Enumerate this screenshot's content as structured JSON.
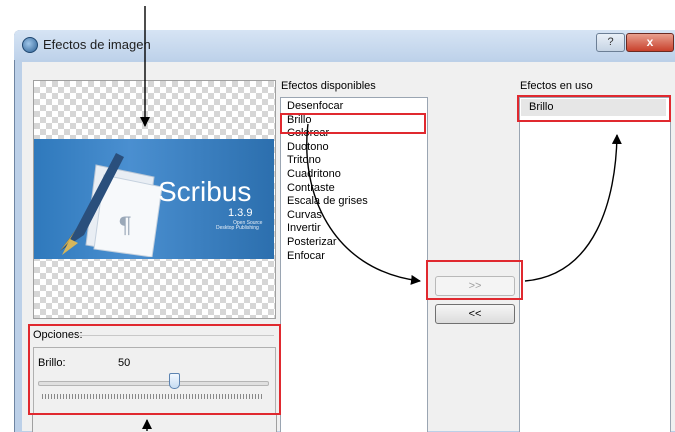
{
  "window": {
    "title": "Efectos de imagen",
    "help_label": "?",
    "close_label": "x"
  },
  "preview": {
    "app_name": "Scribus",
    "version": "1.3.9",
    "tagline_1": "Open Source",
    "tagline_2": "Desktop Publishing"
  },
  "options": {
    "group_label": "Opciones:",
    "param_label": "Brillo:",
    "param_value": "50",
    "slider_fraction": 0.6
  },
  "available": {
    "header": "Efectos disponibles",
    "items": [
      "Desenfocar",
      "Brillo",
      "Colorear",
      "Duotono",
      "Tritono",
      "Cuadritono",
      "Contraste",
      "Escala de grises",
      "Curvas",
      "Invertir",
      "Posterizar",
      "Enfocar"
    ],
    "highlighted": "Brillo"
  },
  "in_use": {
    "header": "Efectos en uso",
    "items": [
      "Brillo"
    ]
  },
  "buttons": {
    "add_label": ">>",
    "remove_label": "<<"
  },
  "colors": {
    "annotation_red": "#e0292f",
    "splash_blue": "#2f79bc",
    "titlebar": "#c8d9ee"
  }
}
